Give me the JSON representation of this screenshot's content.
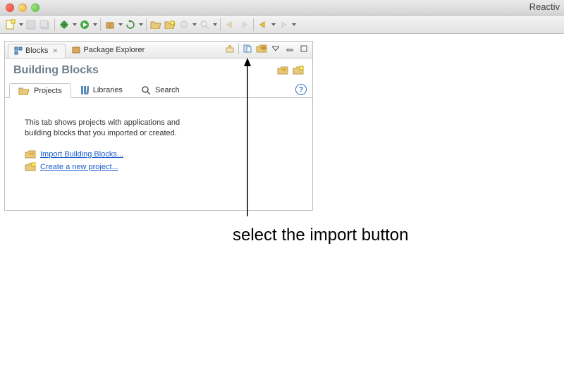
{
  "window": {
    "title_fragment": "Reactiv"
  },
  "views": {
    "blocks": {
      "label": "Blocks"
    },
    "package_explorer": {
      "label": "Package Explorer"
    }
  },
  "panel": {
    "title": "Building Blocks",
    "tabs": {
      "projects": {
        "label": "Projects"
      },
      "libraries": {
        "label": "Libraries"
      },
      "search": {
        "label": "Search"
      }
    },
    "body": {
      "description": "This tab shows projects with applications and building blocks that you imported or created.",
      "import_link": "Import Building Blocks...",
      "create_link": "Create a new project..."
    }
  },
  "annotation": {
    "text": "select the import button"
  }
}
